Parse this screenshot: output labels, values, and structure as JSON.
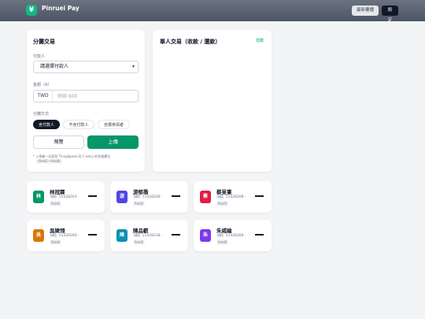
{
  "header": {
    "app_title": "Pinruei Pay",
    "logo_glyph": "¥",
    "sync_label": "最新覆播",
    "settings_label": "設定"
  },
  "split": {
    "title": "分攤交易",
    "payer_label": "付款人",
    "payer_select": "請選擇付款人",
    "amount_label": "金額（A）",
    "currency": "TWD",
    "amount_placeholder": "例如 600",
    "mode_label": "分攤方式",
    "modes": [
      "含付款人",
      "不含付款人",
      "自選參與者"
    ],
    "preview_label": "預覽",
    "upload_label": "上傳",
    "note": "* 上傳會一次寫到 ThingSpeak 同 1 entry 的多個欄位",
    "note_code": "(field1~field8)"
  },
  "single": {
    "title": "單人交易（收款 / 還款）",
    "link": "隱藏"
  },
  "people": [
    {
      "avatar": "林",
      "name": "林冠霖",
      "sid": "SID",
      "id_text": "11428203 ·",
      "field": "field1",
      "value": "—",
      "color": "#059669"
    },
    {
      "avatar": "游",
      "name": "游郁喬",
      "sid": "SID",
      "id_text": "11428206 ·",
      "field": "field2",
      "value": "—",
      "color": "#4f46e5"
    },
    {
      "avatar": "蔡",
      "name": "蔡旻憲",
      "sid": "SID",
      "id_text": "11428208 ·",
      "field": "field3",
      "value": "—",
      "color": "#e11d48"
    },
    {
      "avatar": "吳",
      "name": "吳婕翎",
      "sid": "SID",
      "id_text": "11428260 ·",
      "field": "field4",
      "value": "—",
      "color": "#d97706"
    },
    {
      "avatar": "陳",
      "name": "陳品叡",
      "sid": "SID",
      "id_text": "11428218 ·",
      "field": "field5",
      "value": "—",
      "color": "#0891b2"
    },
    {
      "avatar": "朱",
      "name": "朱威綸",
      "sid": "SID",
      "id_text": "11428266 ·",
      "field": "field6",
      "value": "—",
      "color": "#7c3aed"
    }
  ]
}
